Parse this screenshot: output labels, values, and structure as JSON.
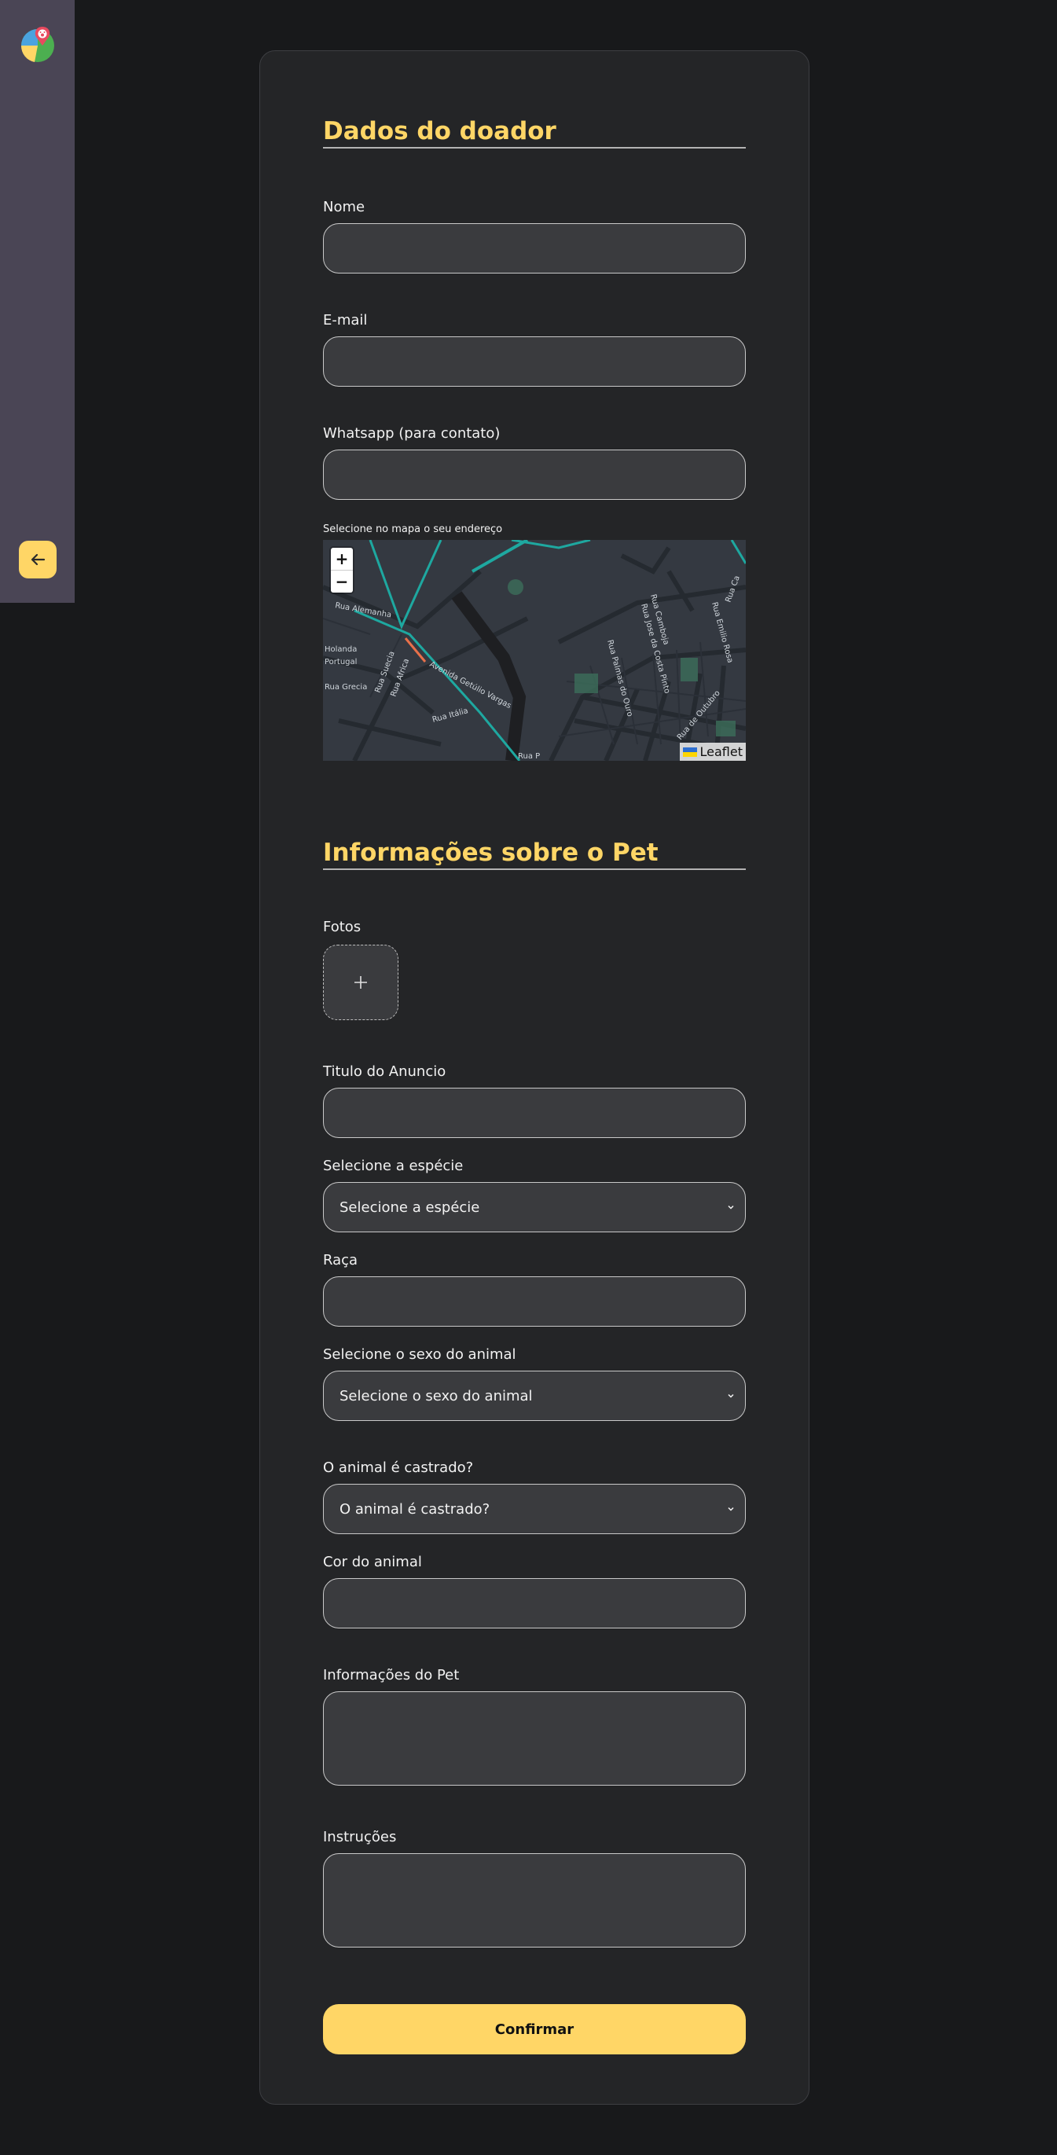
{
  "sidebar": {
    "back_icon": "arrow-left-icon",
    "logo_icon": "pet-map-logo-icon"
  },
  "donor": {
    "title": "Dados do doador",
    "name_label": "Nome",
    "email_label": "E-mail",
    "whatsapp_label": "Whatsapp (para contato)",
    "map_label": "Selecione no mapa o seu endereço",
    "map": {
      "zoom_in": "+",
      "zoom_out": "−",
      "attribution": "Leaflet",
      "streets": [
        "Rua Alemanha",
        "Holanda",
        "Portugal",
        "Rua Grecia",
        "Rua Itália",
        "Avenida Getúlio Vargas",
        "Rua Suecia",
        "Rua Africa",
        "Rua Palmas do Ouro",
        "Rua Camboja",
        "Rua Jose da Costa Pinto",
        "Rua Emilio Rosa",
        "Rua Ca",
        "Rua de Outubro",
        "Rua P"
      ]
    }
  },
  "pet": {
    "title": "Informações sobre o Pet",
    "photos_label": "Fotos",
    "add_photo": "+",
    "ad_title_label": "Titulo do Anuncio",
    "species_label": "Selecione a espécie",
    "species_value": "Selecione a espécie",
    "breed_label": "Raça",
    "sex_label": "Selecione o sexo do animal",
    "sex_value": "Selecione o sexo do animal",
    "neutered_label": "O animal é castrado?",
    "neutered_value": "O animal é castrado?",
    "color_label": "Cor do animal",
    "info_label": "Informações do Pet",
    "instructions_label": "Instruções",
    "confirm": "Confirmar"
  },
  "colors": {
    "accent": "#ffd666",
    "background": "#18191b",
    "card": "#242527",
    "sidebar": "#4a4555"
  }
}
